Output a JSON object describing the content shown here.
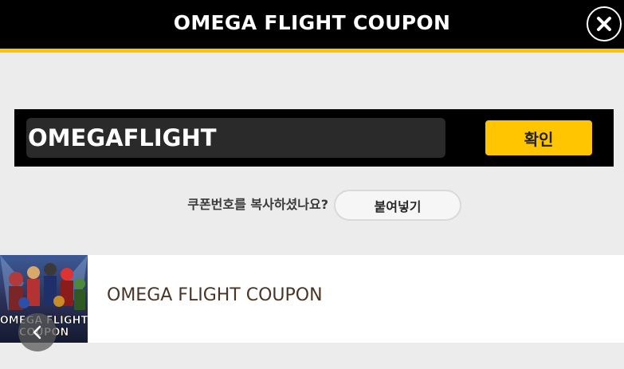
{
  "header": {
    "title": "OMEGA FLIGHT COUPON",
    "close_icon": "close-icon"
  },
  "coupon": {
    "input_value": "OMEGAFLIGHT",
    "confirm_label": "확인"
  },
  "paste": {
    "prompt": "쿠폰번호를 복사하셨나요?",
    "button_label": "붙여넣기"
  },
  "card": {
    "title": "OMEGA FLIGHT COUPON",
    "thumbnail_line1": "OMEGA FLIGHT",
    "thumbnail_line2": "COUPON"
  },
  "nav": {
    "back_icon": "chevron-left-icon"
  },
  "colors": {
    "accent": "#ffc500",
    "header_bg": "#000000",
    "page_bg": "#ececec",
    "card_title": "#4a3426"
  }
}
